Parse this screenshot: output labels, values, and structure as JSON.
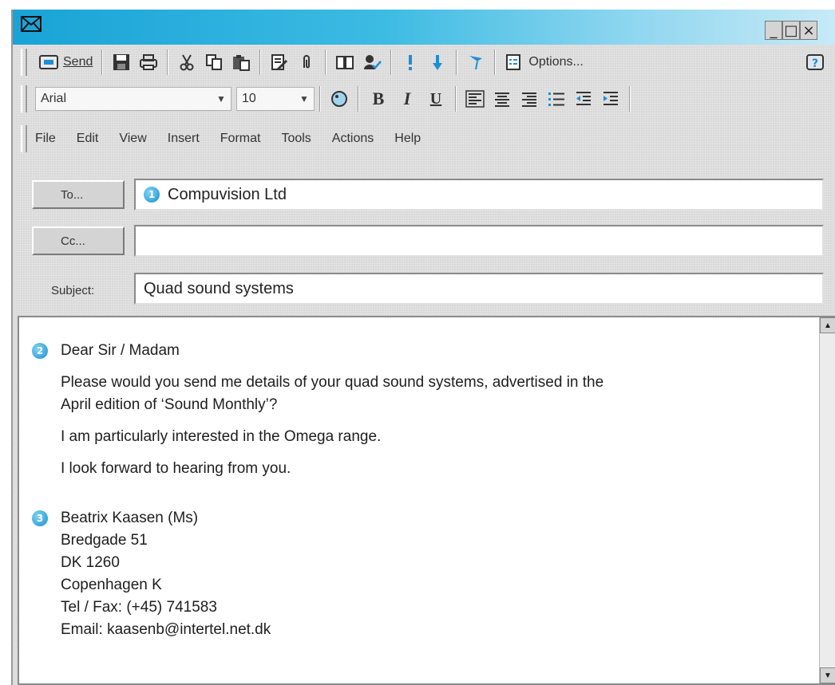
{
  "window": {
    "controls": [
      "_",
      "□",
      "×"
    ]
  },
  "toolbar": {
    "send_label": "Send",
    "options_label": "Options..."
  },
  "format": {
    "font": "Arial",
    "size": "10",
    "bold": "B",
    "italic": "I",
    "underline": "U"
  },
  "menu": [
    "File",
    "Edit",
    "View",
    "Insert",
    "Format",
    "Tools",
    "Actions",
    "Help"
  ],
  "header": {
    "to_button": "To...",
    "to_value": "Compuvision Ltd",
    "to_badge": "1",
    "cc_button": "Cc...",
    "cc_value": "",
    "subject_label": "Subject:",
    "subject_value": "Quad sound systems"
  },
  "body": {
    "greeting_badge": "2",
    "greeting": "Dear Sir / Madam",
    "para1_line1": "Please would you send me details of your quad sound systems, advertised in the",
    "para1_line2": "April edition of ‘Sound Monthly’?",
    "para2": "I am particularly interested in the Omega range.",
    "para3": "I look forward to hearing from you.",
    "signature_badge": "3",
    "signature": [
      "Beatrix Kaasen (Ms)",
      "Bredgade 51",
      "DK 1260",
      "Copenhagen K",
      "Tel / Fax: (+45) 741583",
      "Email: kaasenb@intertel.net.dk"
    ]
  },
  "colors": {
    "titlebar_start": "#19a3d6",
    "titlebar_end": "#c7eaf6",
    "badge": "#1a8fcf",
    "priority_blue": "#1f8ed6"
  }
}
